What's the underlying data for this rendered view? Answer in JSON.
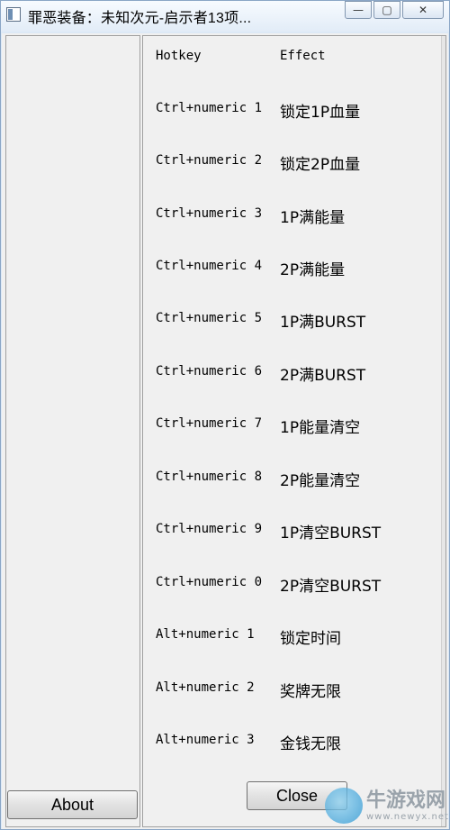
{
  "window": {
    "title": "罪恶装备：未知次元-启示者13项...",
    "controls": {
      "minimize": "—",
      "maximize": "▢",
      "close": "✕"
    }
  },
  "table": {
    "headers": {
      "hotkey": "Hotkey",
      "effect": "Effect"
    },
    "rows": [
      {
        "hotkey": "Ctrl+numeric 1",
        "effect": "锁定1P血量"
      },
      {
        "hotkey": "Ctrl+numeric 2",
        "effect": "锁定2P血量"
      },
      {
        "hotkey": "Ctrl+numeric 3",
        "effect": "1P满能量"
      },
      {
        "hotkey": "Ctrl+numeric 4",
        "effect": "2P满能量"
      },
      {
        "hotkey": "Ctrl+numeric 5",
        "effect": "1P满BURST"
      },
      {
        "hotkey": "Ctrl+numeric 6",
        "effect": "2P满BURST"
      },
      {
        "hotkey": "Ctrl+numeric 7",
        "effect": "1P能量清空"
      },
      {
        "hotkey": "Ctrl+numeric 8",
        "effect": "2P能量清空"
      },
      {
        "hotkey": "Ctrl+numeric 9",
        "effect": "1P清空BURST"
      },
      {
        "hotkey": "Ctrl+numeric 0",
        "effect": "2P清空BURST"
      },
      {
        "hotkey": "Alt+numeric 1",
        "effect": "锁定时间"
      },
      {
        "hotkey": "Alt+numeric 2",
        "effect": "奖牌无限"
      },
      {
        "hotkey": "Alt+numeric 3",
        "effect": "金钱无限"
      }
    ]
  },
  "buttons": {
    "about": "About",
    "close": "Close"
  },
  "watermark": {
    "name": "牛游戏网",
    "url": "www.newyx.net"
  }
}
